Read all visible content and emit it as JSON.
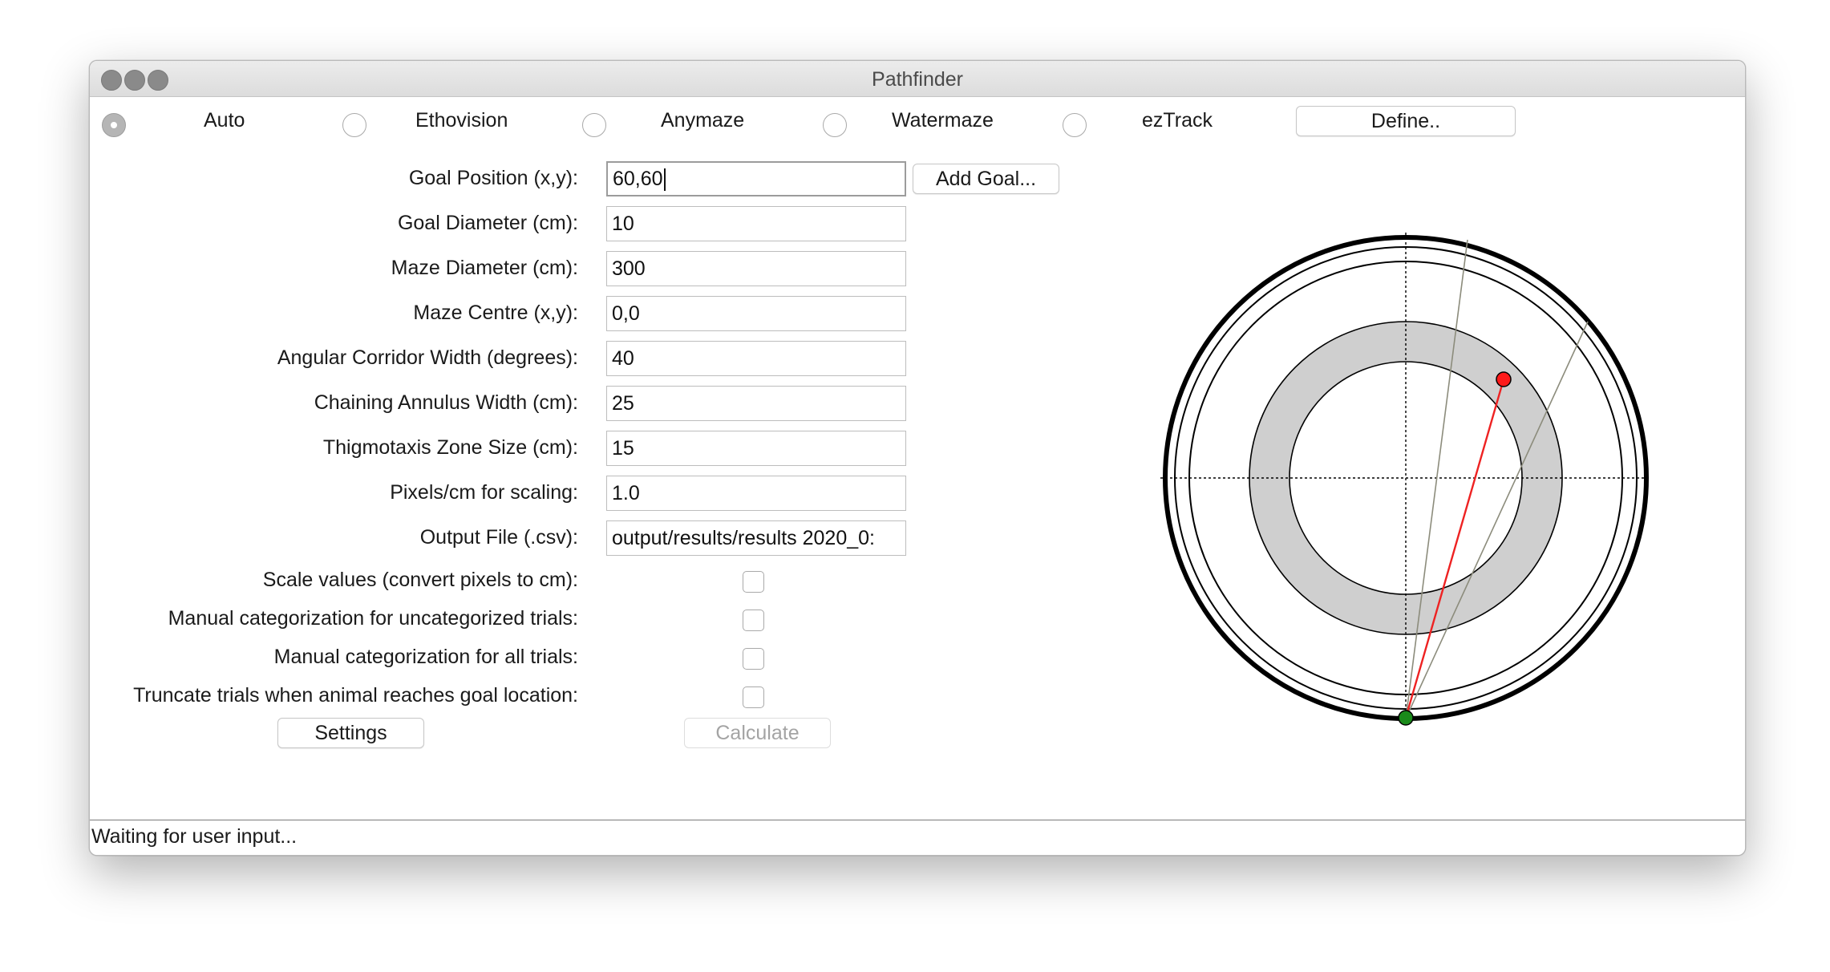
{
  "window": {
    "title": "Pathfinder"
  },
  "software": {
    "options": [
      {
        "label": "Auto",
        "selected": true
      },
      {
        "label": "Ethovision",
        "selected": false
      },
      {
        "label": "Anymaze",
        "selected": false
      },
      {
        "label": "Watermaze",
        "selected": false
      },
      {
        "label": "ezTrack",
        "selected": false
      }
    ],
    "define_label": "Define.."
  },
  "fields": [
    {
      "label": "Goal Position (x,y):",
      "value": "60,60"
    },
    {
      "label": "Goal Diameter (cm):",
      "value": "10"
    },
    {
      "label": "Maze Diameter (cm):",
      "value": "300"
    },
    {
      "label": "Maze Centre (x,y):",
      "value": "0,0"
    },
    {
      "label": "Angular Corridor Width (degrees):",
      "value": "40"
    },
    {
      "label": "Chaining Annulus Width (cm):",
      "value": "25"
    },
    {
      "label": "Thigmotaxis Zone Size (cm):",
      "value": "15"
    },
    {
      "label": "Pixels/cm for scaling:",
      "value": "1.0"
    },
    {
      "label": "Output File (.csv):",
      "value": "output/results/results 2020_0:"
    }
  ],
  "add_goal_label": "Add Goal...",
  "checkboxes": [
    {
      "label": "Scale values (convert pixels to cm):",
      "checked": false
    },
    {
      "label": "Manual categorization for uncategorized trials:",
      "checked": false
    },
    {
      "label": "Manual categorization for all trials:",
      "checked": false
    },
    {
      "label": "Truncate trials when animal reaches goal location:",
      "checked": false
    }
  ],
  "buttons": {
    "settings": "Settings",
    "calculate": "Calculate"
  },
  "status": "Waiting for user input...",
  "colors": {
    "annulus": "#cfcfcf",
    "goal_marker": "#ff1a1a",
    "start_marker": "#1a8a1a",
    "path_line": "#ee2222",
    "corridor_lines": "#8c8c7c"
  }
}
